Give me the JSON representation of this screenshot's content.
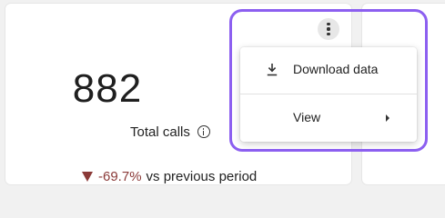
{
  "metric_card": {
    "value": "882",
    "label": "Total calls",
    "trend": {
      "direction": "down",
      "arrow_icon": "triangle-down-icon",
      "change": "-69.7%",
      "comparison": "vs previous period"
    }
  },
  "more_menu": {
    "icon": "more-vertical-icon",
    "items": [
      {
        "label": "Download data",
        "icon": "download-icon"
      },
      {
        "label": "View",
        "icon": "chevron-right-icon"
      }
    ]
  },
  "colors": {
    "accent_focus": "#8c5ff0",
    "trend_down": "#8b3a38",
    "background": "#f1f1f1",
    "card": "#ffffff"
  }
}
